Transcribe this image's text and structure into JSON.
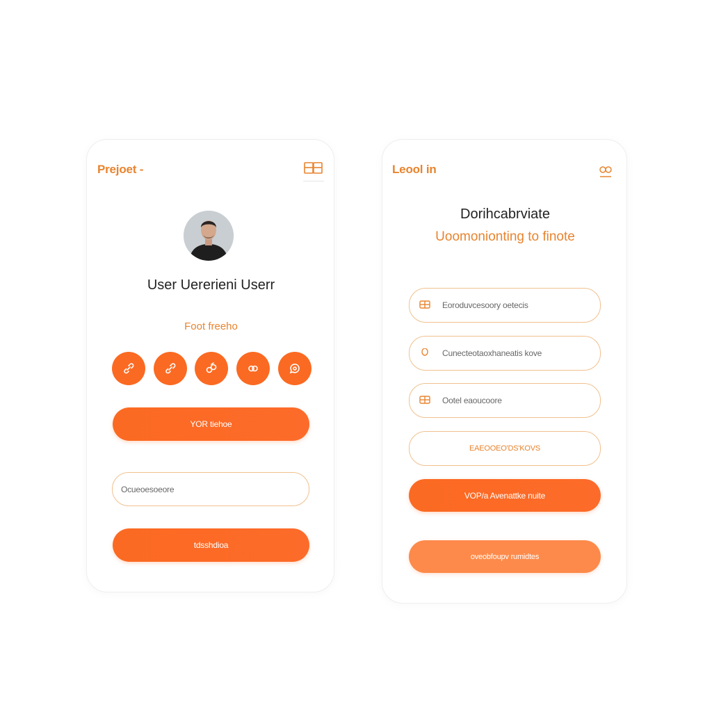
{
  "colors": {
    "accent": "#fb6a22",
    "accent_text": "#e8842f",
    "outline": "#f0c08e"
  },
  "left_card": {
    "title": "Prejoet -",
    "header_icon": "book-icon",
    "user_name": "User Uererieni Userr",
    "sub_label": "Foot freeho",
    "action_icons": [
      "link-icon",
      "link-icon",
      "share-icon",
      "group-icon",
      "chat-icon"
    ],
    "primary_button": "YOR tiehoe",
    "input_placeholder": "Ocueoesoeore",
    "secondary_button": "tdsshdioa"
  },
  "right_card": {
    "title": "Leool in",
    "header_icon": "settings-icon",
    "heading_dark": "Dorihcabrviate",
    "heading_orange": "Uoomonionting to finote",
    "fields": [
      {
        "icon": "card-icon",
        "text": "Eoroduvcesoory oetecis"
      },
      {
        "icon": "lock-icon",
        "text": "Cunecteotaoxhaneatis kove"
      },
      {
        "icon": "card-icon",
        "text": "Ootel eaoucoore"
      }
    ],
    "outline_button": "EAEOOEO'DS'KOVS",
    "primary_button": "VOP/a Avenattke nuite",
    "light_button": "oveobfoupv rumidtes"
  }
}
